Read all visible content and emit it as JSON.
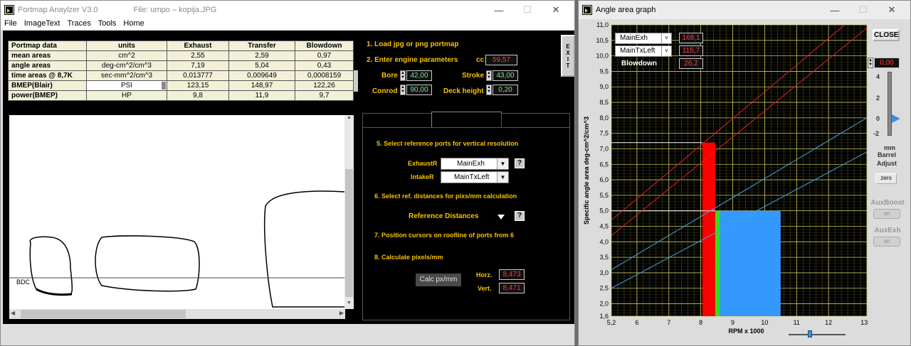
{
  "left_window": {
    "title": "Portmap Anaylzer V3.0",
    "file_label": "File: umpo – kopija.JPG",
    "menu": [
      "File",
      "ImageText",
      "Traces",
      "Tools",
      "Home"
    ],
    "table": {
      "headers": [
        "Portmap data",
        "units",
        "Exhaust",
        "Transfer",
        "Blowdown"
      ],
      "rows": [
        {
          "label": "mean areas",
          "unit": "cm^2",
          "exhaust": "2,55",
          "transfer": "2,59",
          "blowdown": "0,97"
        },
        {
          "label": "angle areas",
          "unit": "deg-cm^2/cm^3",
          "exhaust": "7,19",
          "transfer": "5,04",
          "blowdown": "0,43"
        },
        {
          "label": "time areas @ 8,7K",
          "unit": "sec-mm^2/cm^3",
          "exhaust": "0,013777",
          "transfer": "0,009649",
          "blowdown": "0,0008159"
        },
        {
          "label": "BMEP(Blair)",
          "unit": "PSI",
          "exhaust": "123,15",
          "transfer": "148,97",
          "blowdown": "122,26"
        },
        {
          "label": "power(BMEP)",
          "unit": "HP",
          "exhaust": "9,8",
          "transfer": "11,9",
          "blowdown": "9,7"
        }
      ]
    },
    "canvas": {
      "bdc_label": "BDC"
    },
    "steps": {
      "s1": "1. Load jpg or png portmap",
      "s2": "2. Enter engine parameters",
      "cc_label": "cc",
      "cc_value": "59,57",
      "bore_label": "Bore",
      "bore_value": "42,00",
      "stroke_label": "Stroke",
      "stroke_value": "43,00",
      "conrod_label": "Conrod",
      "conrod_value": "90,00",
      "deck_label": "Deck height",
      "deck_value": "0,20",
      "exit_label": "EXIT",
      "s5": "5. Select reference ports for vertical resolution",
      "exhaustR_label": "ExhaustR",
      "exhaustR_value": "MainExh",
      "intakeR_label": "IntakeR",
      "intakeR_value": "MainTxLeft",
      "help_label": "?",
      "s6": "6. Select ref. distances for pixs/mm calculation",
      "ref_distances": "Reference Distances",
      "s7": "7. Position cursors on roofline of ports from 6",
      "s8": "8. Calculate pixels/mm",
      "calc_btn": "Calc px/mm",
      "horz_label": "Horz.",
      "horz_value": "8,473",
      "vert_label": "Vert.",
      "vert_value": "8,471"
    }
  },
  "right_window": {
    "title": "Angle area graph",
    "close_btn": "CLOSE",
    "legend": [
      {
        "name": "MainExh",
        "value": "168,1"
      },
      {
        "name": "MainTxLeft",
        "value": "115,7"
      },
      {
        "name": "Blowdown",
        "value": "26,2"
      }
    ],
    "barrel": {
      "value": "0,00",
      "ticks": [
        "4",
        "2",
        "0",
        "-2"
      ],
      "mm": "mm",
      "label1": "Barrel",
      "label2": "Adjust",
      "zero_btn": "zero"
    },
    "auxboost": {
      "label": "AuxBoost",
      "btn": "on"
    },
    "auxexh": {
      "label": "AuxExh",
      "btn": "on"
    },
    "colors": {
      "exhaust_line": "#e02020",
      "transfer_line": "#4aa0e0",
      "red_bar": "#ff0000",
      "green_bar": "#33dd22",
      "blue_bar": "#3399ff",
      "grid": "#c8c860"
    }
  },
  "chart_data": {
    "type": "line",
    "xlabel": "RPM x 1000",
    "ylabel": "Specific angle area deg-cm^2/cm^3",
    "xlim": [
      5.2,
      13.2
    ],
    "ylim": [
      1.6,
      11.0
    ],
    "xticks": [
      "5,2",
      "6",
      "7",
      "8",
      "9",
      "10",
      "11",
      "12",
      "13,2"
    ],
    "yticks": [
      "1,6",
      "2,0",
      "2,5",
      "3,0",
      "3,5",
      "4,0",
      "4,5",
      "5,0",
      "5,5",
      "6,0",
      "6,5",
      "7,0",
      "7,5",
      "8,0",
      "8,5",
      "9,0",
      "9,5",
      "10,0",
      "10,5",
      "11,0"
    ],
    "series": [
      {
        "color": "#e02020",
        "x": [
          5.2,
          13.2
        ],
        "y": [
          4.7,
          11.6
        ]
      },
      {
        "color": "#e02020",
        "x": [
          5.2,
          13.2
        ],
        "y": [
          4.2,
          10.9
        ]
      },
      {
        "color": "#4aa0e0",
        "x": [
          5.2,
          13.2
        ],
        "y": [
          3.1,
          8.0
        ]
      },
      {
        "color": "#4aa0e0",
        "x": [
          5.2,
          13.2
        ],
        "y": [
          2.5,
          6.9
        ]
      }
    ],
    "bars": [
      {
        "x0": 8.05,
        "x1": 8.45,
        "y": 7.2,
        "color": "#ff0000"
      },
      {
        "x0": 8.45,
        "x1": 8.6,
        "y": 5.0,
        "color": "#33dd22"
      },
      {
        "x0": 8.6,
        "x1": 10.5,
        "y": 5.0,
        "color": "#3399ff"
      }
    ],
    "hlines": [
      {
        "x0": 5.2,
        "x1": 8.05,
        "y": 7.2
      },
      {
        "x0": 5.2,
        "x1": 8.45,
        "y": 5.0
      }
    ]
  }
}
